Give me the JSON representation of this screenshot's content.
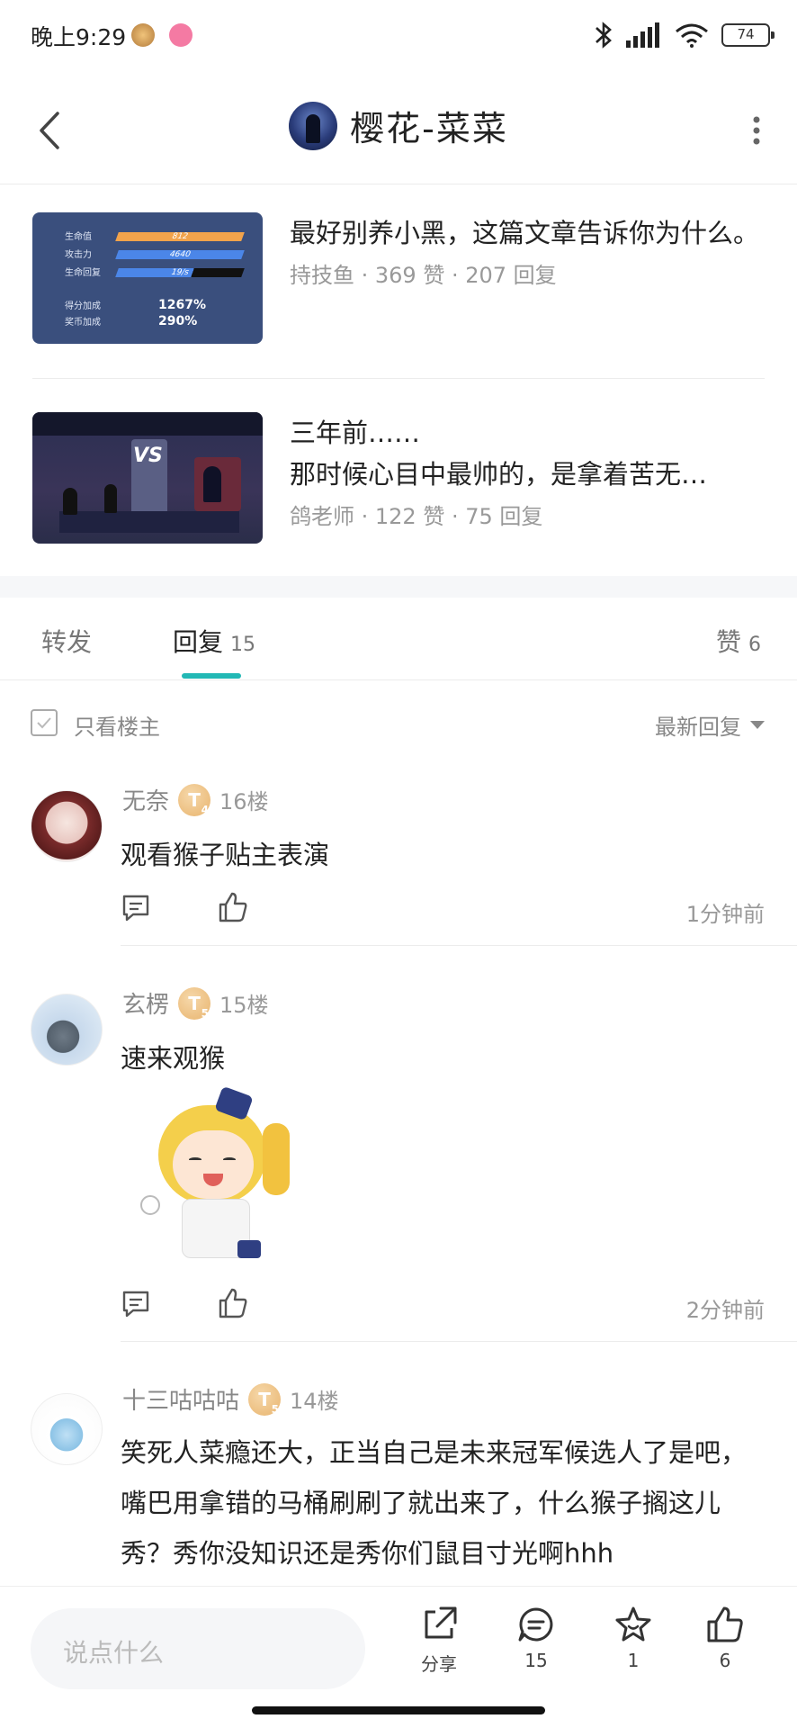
{
  "status_bar": {
    "time": "晚上9:29",
    "battery": "74"
  },
  "header": {
    "title": "樱花-菜菜"
  },
  "related_articles": [
    {
      "title": "最好别养小黑，这篇文章告诉你为什么。",
      "meta": "持技鱼 · 369 赞 · 207 回复",
      "thumb_stats": [
        {
          "label": "生命值",
          "value": "812",
          "color": "#f2a34b"
        },
        {
          "label": "攻击力",
          "value": "4640",
          "color": "#4b86e8"
        },
        {
          "label": "生命回复",
          "value": "19/s",
          "color": "#4b86e8"
        }
      ],
      "thumb_bonus": [
        {
          "label": "得分加成",
          "value": "1267%"
        },
        {
          "label": "奖币加成",
          "value": "290%"
        }
      ]
    },
    {
      "title": "三年前……",
      "subtitle": "那时候心目中最帅的，是拿着苦无…",
      "meta": "鸽老师 · 122 赞 · 75 回复",
      "thumb_text": "VS"
    }
  ],
  "tabs": [
    {
      "label": "转发",
      "count": ""
    },
    {
      "label": "回复",
      "count": "15"
    },
    {
      "label": "赞",
      "count": "6"
    }
  ],
  "filter": {
    "only_owner": "只看楼主",
    "sort": "最新回复"
  },
  "comments": [
    {
      "name": "无奈",
      "badge": "T",
      "level": "4",
      "floor": "16楼",
      "text": "观看猴子贴主表演",
      "time": "1分钟前"
    },
    {
      "name": "玄楞",
      "badge": "T",
      "level": "5",
      "floor": "15楼",
      "text": "速来观猴",
      "time": "2分钟前"
    },
    {
      "name": "十三咕咕咕",
      "badge": "T",
      "level": "5",
      "floor": "14楼",
      "text": "笑死人菜瘾还大，正当自己是未来冠军候选人了是吧，嘴巴用拿错的马桶刷刷了就出来了，什么猴子搁这儿秀？秀你没知识还是秀你们鼠目寸光啊hhh"
    }
  ],
  "bottom_bar": {
    "placeholder": "说点什么",
    "share_label": "分享",
    "comment_count": "15",
    "favorite_count": "1",
    "like_count": "6"
  },
  "colors": {
    "accent": "#22b8b5",
    "badge": "#e8b46e"
  }
}
